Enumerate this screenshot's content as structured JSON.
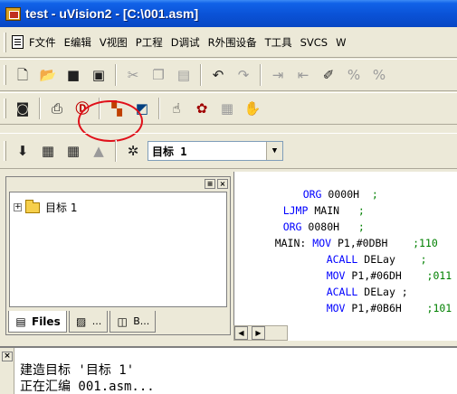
{
  "window": {
    "title": "test  - uVision2 - [C:\\001.asm]"
  },
  "menu": {
    "items": [
      "F文件",
      "E编辑",
      "V视图",
      "P工程",
      "D调试",
      "R外围设备",
      "T工具",
      "SVCS",
      "W"
    ]
  },
  "toolbar1": {
    "buttons": [
      "new-file",
      "open-file",
      "save",
      "save-all",
      "cut",
      "copy",
      "paste",
      "undo",
      "redo",
      "indent",
      "unindent",
      "bookmark",
      "toggle-bookmark",
      "find"
    ]
  },
  "toolbar2": {
    "buttons": [
      "project",
      "print",
      "debug-session",
      "target-options",
      "pin-window",
      "hand",
      "watch",
      "window-grey",
      "hand-grey"
    ]
  },
  "toolbar3": {
    "target_select": {
      "value": "目标 1"
    }
  },
  "project_panel": {
    "tree": [
      {
        "expander": "+",
        "label": "目标 1"
      }
    ],
    "tabs": [
      {
        "label": "Files",
        "icon": "files-icon"
      },
      {
        "label": "...",
        "icon": "regs-icon"
      },
      {
        "label": "B...",
        "icon": "books-icon"
      }
    ]
  },
  "editor": {
    "lines": [
      {
        "label": "",
        "mnemonic": "ORG",
        "operand": "0000H",
        "comment": ";"
      },
      {
        "label": "",
        "mnemonic": "LJMP",
        "operand": "MAIN",
        "comment": ";"
      },
      {
        "label": "",
        "mnemonic": "ORG",
        "operand": "0080H",
        "comment": ";"
      },
      {
        "label": "MAIN:",
        "mnemonic": "MOV",
        "operand": "P1,#0DBH",
        "comment": ";110"
      },
      {
        "label": "",
        "mnemonic": "ACALL",
        "operand": "DELay",
        "comment": ";"
      },
      {
        "label": "",
        "mnemonic": "MOV",
        "operand": "P1,#06DH",
        "comment": ";011"
      },
      {
        "label": "",
        "mnemonic": "ACALL",
        "operand": "DELay ;",
        "comment": ""
      },
      {
        "label": "",
        "mnemonic": "MOV",
        "operand": "P1,#0B6H",
        "comment": ";101"
      }
    ]
  },
  "output": {
    "lines": [
      "建造目标 '目标 1'",
      "正在汇编 001.asm..."
    ]
  }
}
